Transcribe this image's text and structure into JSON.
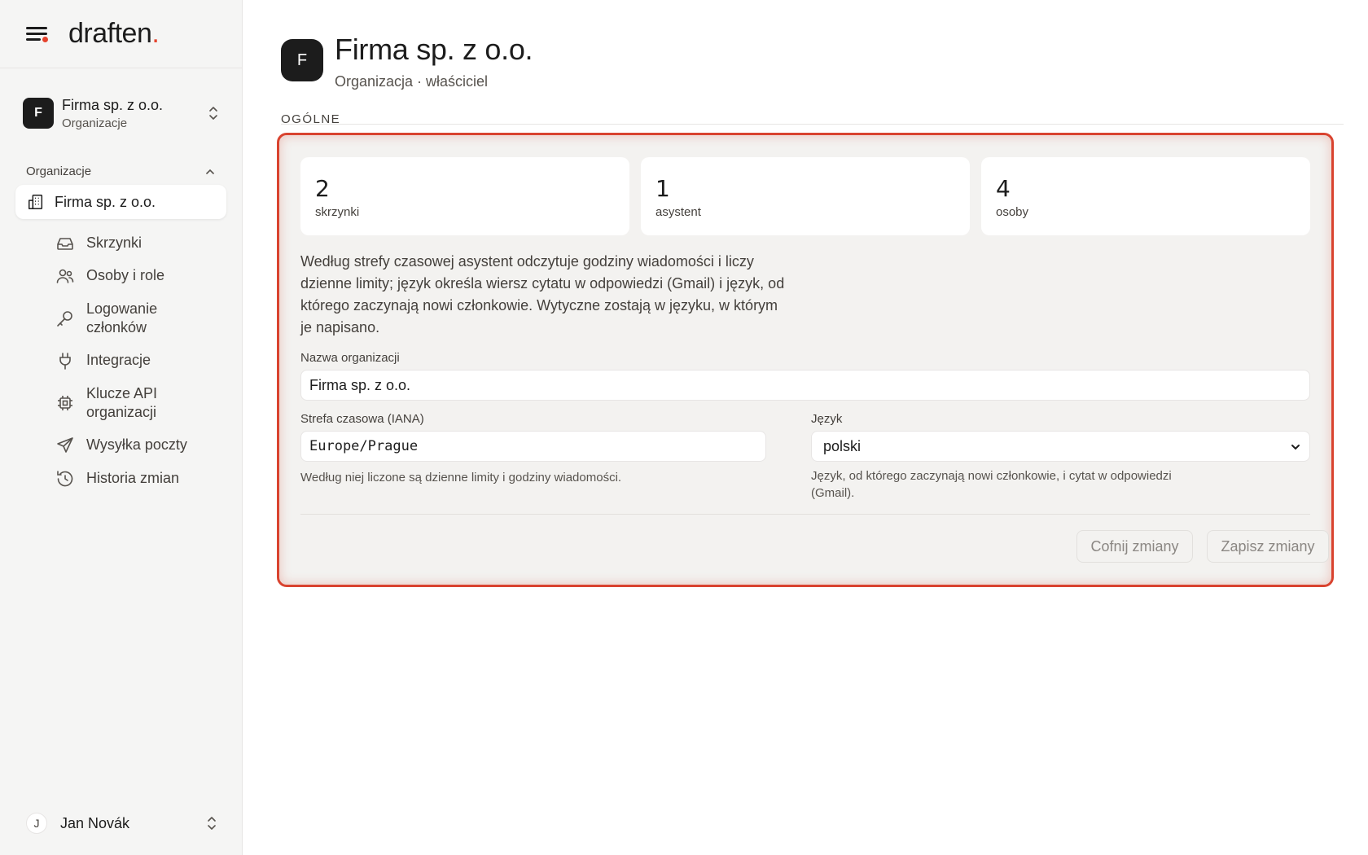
{
  "app": {
    "logo_text": "draften",
    "logo_dot": "."
  },
  "sidebar": {
    "org_switcher": {
      "avatar": "F",
      "name": "Firma sp. z o.o.",
      "subtitle": "Organizacje"
    },
    "section_title": "Organizacje",
    "active_item": "Firma sp. z o.o.",
    "items": [
      {
        "label": "Skrzynki",
        "icon": "inbox-icon"
      },
      {
        "label": "Osoby i role",
        "icon": "users-icon"
      },
      {
        "label": "Logowanie członków",
        "icon": "key-icon"
      },
      {
        "label": "Integracje",
        "icon": "plug-icon"
      },
      {
        "label": "Klucze API organizacji",
        "icon": "chip-icon"
      },
      {
        "label": "Wysyłka poczty",
        "icon": "send-icon"
      },
      {
        "label": "Historia zmian",
        "icon": "history-icon"
      }
    ],
    "user": {
      "initial": "J",
      "name": "Jan Novák"
    }
  },
  "header": {
    "avatar": "F",
    "title": "Firma sp. z o.o.",
    "subtitle": "Organizacja · właściciel"
  },
  "section": {
    "label": "OGÓLNE"
  },
  "stats": [
    {
      "value": "2",
      "label": "skrzynki"
    },
    {
      "value": "1",
      "label": "asystent"
    },
    {
      "value": "4",
      "label": "osoby"
    }
  ],
  "description": "Według strefy czasowej asystent odczytuje godziny wiadomości i liczy dzienne limity; język określa wiersz cytatu w odpowiedzi (Gmail) i język, od którego zaczynają nowi członkowie. Wytyczne zostają w języku, w którym je napisano.",
  "form": {
    "org_name_label": "Nazwa organizacji",
    "org_name_value": "Firma sp. z o.o.",
    "timezone_label": "Strefa czasowa (IANA)",
    "timezone_value": "Europe/Prague",
    "timezone_help": "Według niej liczone są dzienne limity i godziny wiadomości.",
    "language_label": "Język",
    "language_value": "polski",
    "language_help": "Język, od którego zaczynają nowi członkowie, i cytat w odpowiedzi (Gmail).",
    "revert_label": "Cofnij zmiany",
    "save_label": "Zapisz zmiany"
  },
  "colors": {
    "accent": "#e5432d",
    "highlight_border": "#d9432f",
    "dark": "#1c1c1c"
  }
}
